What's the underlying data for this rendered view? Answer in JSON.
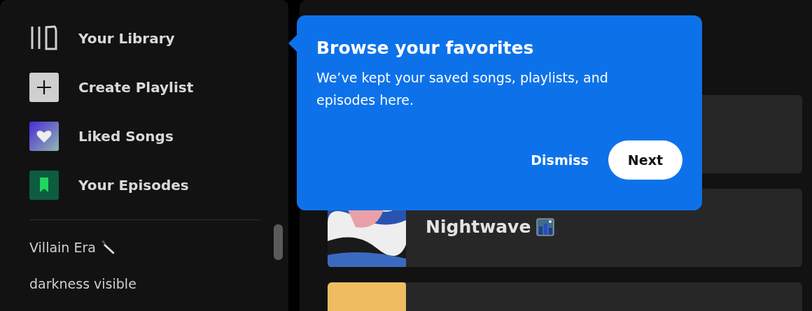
{
  "sidebar": {
    "nav": [
      {
        "kind": "library",
        "label": "Your Library"
      },
      {
        "kind": "create",
        "label": "Create Playlist"
      },
      {
        "kind": "liked",
        "label": "Liked Songs"
      },
      {
        "kind": "episodes",
        "label": "Your Episodes"
      }
    ],
    "playlists": [
      {
        "name": "Villain Era",
        "kind": "emoji"
      },
      {
        "name": "darkness visible",
        "kind": "plain"
      }
    ]
  },
  "main": {
    "cards": [
      {
        "kind": "covered"
      },
      {
        "kind": "featured",
        "title": "Nightwave"
      },
      {
        "kind": "radio"
      }
    ]
  },
  "popover": {
    "title": "Browse your favorites",
    "body": "We’ve kept your saved songs, playlists, and episodes here.",
    "buttons": [
      {
        "kind": "text",
        "label": "Dismiss"
      },
      {
        "kind": "filled",
        "label": "Next"
      }
    ]
  }
}
